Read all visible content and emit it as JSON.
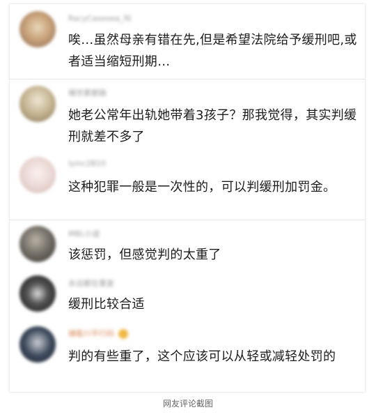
{
  "comments": [
    {
      "username": "RacyCaseoea_叫",
      "text": "唉…虽然母亲有错在先,但是希望法院给予缓刑吧,或者适当缩短刑期…",
      "avatar_color": "#c9a37a"
    },
    {
      "username": "楊世累都路",
      "text": "她老公常年出轨她带着3孩子？那我觉得，其实判缓刑就差不多了",
      "avatar_color": "#bfae8a"
    },
    {
      "username": "lyinc2B10",
      "text": "这种犯罪一般是一次性的，可以判缓刑加罚金。",
      "avatar_color": "#e9d6d2"
    },
    {
      "username": "MBL小谙",
      "text": "该惩罚，但感觉判的太重了",
      "avatar_color": "#6f6a62"
    },
    {
      "username": "永远都在重复",
      "text": "缓刑比较合适",
      "avatar_color": "#2b2b2b"
    },
    {
      "username": "捕看川平行码",
      "text": "判的有些重了，这个应该可以从轻或减轻处罚的",
      "avatar_color": "#3d4a5c"
    }
  ],
  "caption": "网友评论截图"
}
